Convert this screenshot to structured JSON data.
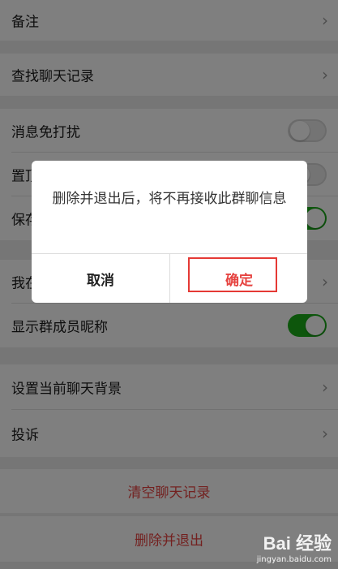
{
  "settings": {
    "remark": "备注",
    "search_history": "查找聊天记录",
    "mute": "消息免打扰",
    "pin_partial": "置顶",
    "save_partial": "保存",
    "my_nick_partial": "我在",
    "show_nicknames": "显示群成员昵称",
    "set_background": "设置当前聊天背景",
    "report": "投诉",
    "clear_history": "清空聊天记录",
    "delete_exit": "删除并退出"
  },
  "toggles": {
    "mute": false,
    "pin": false,
    "save": true,
    "show_nicknames": true
  },
  "dialog": {
    "message": "删除并退出后，将不再接收此群聊信息",
    "cancel": "取消",
    "confirm": "确定"
  },
  "watermark": {
    "logo": "Bai 经验",
    "url": "jingyan.baidu.com"
  },
  "colors": {
    "accent_green": "#1aad19",
    "danger_red": "#e64340",
    "highlight": "#e53935"
  }
}
